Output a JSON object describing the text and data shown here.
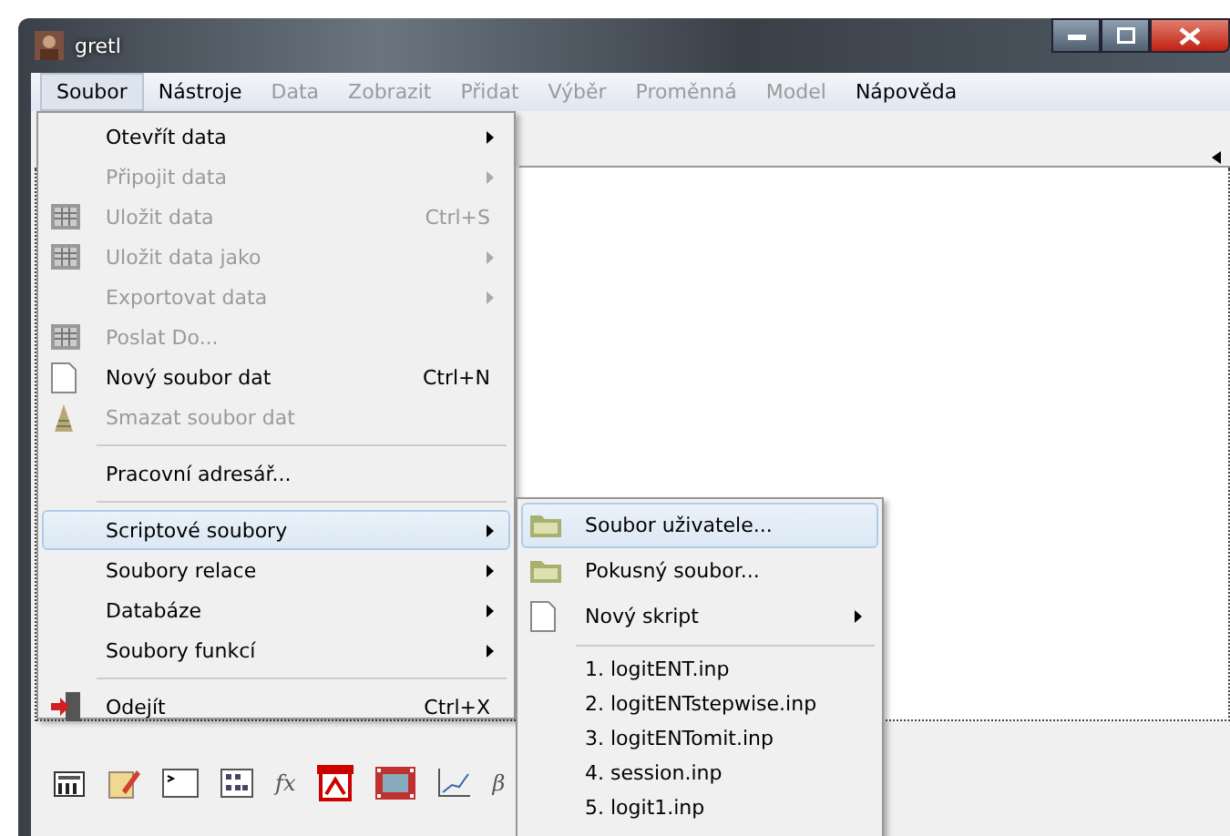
{
  "window": {
    "title": "gretl"
  },
  "menubar": [
    {
      "label": "Soubor",
      "selected": true,
      "disabled": false
    },
    {
      "label": "Nástroje",
      "selected": false,
      "disabled": false
    },
    {
      "label": "Data",
      "selected": false,
      "disabled": true
    },
    {
      "label": "Zobrazit",
      "selected": false,
      "disabled": true
    },
    {
      "label": "Přidat",
      "selected": false,
      "disabled": true
    },
    {
      "label": "Výběr",
      "selected": false,
      "disabled": true
    },
    {
      "label": "Proměnná",
      "selected": false,
      "disabled": true
    },
    {
      "label": "Model",
      "selected": false,
      "disabled": true
    },
    {
      "label": "Nápověda",
      "selected": false,
      "disabled": false
    }
  ],
  "file_menu": [
    {
      "kind": "item",
      "label": "Otevřít data",
      "submenu": true,
      "disabled": false,
      "selected": false
    },
    {
      "kind": "item",
      "label": "Připojit data",
      "submenu": true,
      "disabled": true,
      "selected": false
    },
    {
      "kind": "item",
      "label": "Uložit data",
      "shortcut": "Ctrl+S",
      "disabled": true,
      "selected": false
    },
    {
      "kind": "item",
      "label": "Uložit data jako",
      "submenu": true,
      "disabled": true,
      "selected": false
    },
    {
      "kind": "item",
      "label": "Exportovat data",
      "submenu": true,
      "disabled": true,
      "selected": false
    },
    {
      "kind": "item",
      "label": "Poslat Do...",
      "disabled": true,
      "selected": false
    },
    {
      "kind": "item",
      "label": "Nový soubor dat",
      "shortcut": "Ctrl+N",
      "disabled": false,
      "selected": false
    },
    {
      "kind": "item",
      "label": "Smazat soubor dat",
      "disabled": true,
      "selected": false
    },
    {
      "kind": "separator"
    },
    {
      "kind": "item",
      "label": "Pracovní adresář...",
      "disabled": false,
      "selected": false
    },
    {
      "kind": "separator"
    },
    {
      "kind": "item",
      "label": "Scriptové soubory",
      "submenu": true,
      "disabled": false,
      "selected": true
    },
    {
      "kind": "item",
      "label": "Soubory relace",
      "submenu": true,
      "disabled": false,
      "selected": false
    },
    {
      "kind": "item",
      "label": "Databáze",
      "submenu": true,
      "disabled": false,
      "selected": false
    },
    {
      "kind": "item",
      "label": "Soubory funkcí",
      "submenu": true,
      "disabled": false,
      "selected": false
    },
    {
      "kind": "separator"
    },
    {
      "kind": "item",
      "label": "Odejít",
      "shortcut": "Ctrl+X",
      "disabled": false,
      "selected": false
    }
  ],
  "script_submenu": [
    {
      "kind": "item",
      "label": "Soubor uživatele...",
      "selected": true
    },
    {
      "kind": "item",
      "label": "Pokusný soubor...",
      "selected": false
    },
    {
      "kind": "item",
      "label": "Nový skript",
      "submenu": true,
      "selected": false
    },
    {
      "kind": "separator"
    },
    {
      "kind": "item",
      "label": "1. logitENT.inp",
      "selected": false
    },
    {
      "kind": "item",
      "label": "2. logitENTstepwise.inp",
      "selected": false
    },
    {
      "kind": "item",
      "label": "3. logitENTomit.inp",
      "selected": false
    },
    {
      "kind": "item",
      "label": "4. session.inp",
      "selected": false
    },
    {
      "kind": "item",
      "label": "5. logit1.inp",
      "selected": false
    }
  ],
  "toolbar": [
    {
      "kind": "calc"
    },
    {
      "kind": "edit"
    },
    {
      "kind": "console"
    },
    {
      "kind": "grid"
    },
    {
      "kind": "text",
      "label": "fx"
    },
    {
      "kind": "pdf"
    },
    {
      "kind": "film"
    },
    {
      "kind": "chart"
    },
    {
      "kind": "text",
      "label": "β"
    }
  ]
}
